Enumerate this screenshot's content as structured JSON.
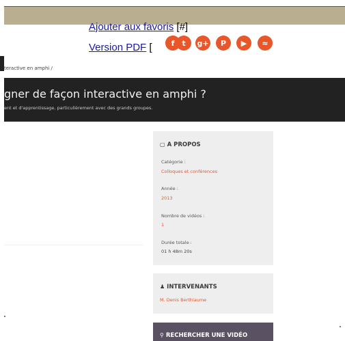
{
  "overlay": {
    "favorites_link": "Ajouter aux favoris",
    "favorites_suffix": "[#]",
    "pdf_link": "Version PDF",
    "pdf_suffix": "["
  },
  "social": [
    {
      "icon": "facebook-icon",
      "glyph": "f"
    },
    {
      "icon": "twitter-icon",
      "glyph": "t"
    },
    {
      "icon": "google-plus-icon",
      "glyph": "g+"
    },
    {
      "icon": "pinterest-icon",
      "glyph": "P"
    },
    {
      "icon": "youtube-icon",
      "glyph": "▶"
    },
    {
      "icon": "rss-icon",
      "glyph": "≈"
    }
  ],
  "breadcrumb": "teractive en amphi /",
  "hero": {
    "title": "gner de façon interactive en amphi ?",
    "subtitle": "ent et d'apprentissage, particulièrement avec des grands groupes."
  },
  "sidebar": {
    "about": {
      "title": "A PROPOS",
      "category_label": "Catégorie :",
      "category_value": "Colloques et conférences",
      "year_label": "Année :",
      "year_value": "2013",
      "videos_label": "Nombre de vidéos :",
      "videos_value": "1",
      "duration_label": "Durée totale :",
      "duration_value": "01 h 48m 20s"
    },
    "speakers": {
      "title": "INTERVENANTS",
      "name": "M. Denis Berthiaume"
    },
    "search": {
      "title": "RECHERCHER UNE VIDÉO"
    }
  },
  "colors": {
    "topbar": "#b9ae8f",
    "accent": "#e8562a",
    "hero_bg": "#222222",
    "card_bg": "#eeeeee",
    "search_bg": "#5a5162"
  }
}
